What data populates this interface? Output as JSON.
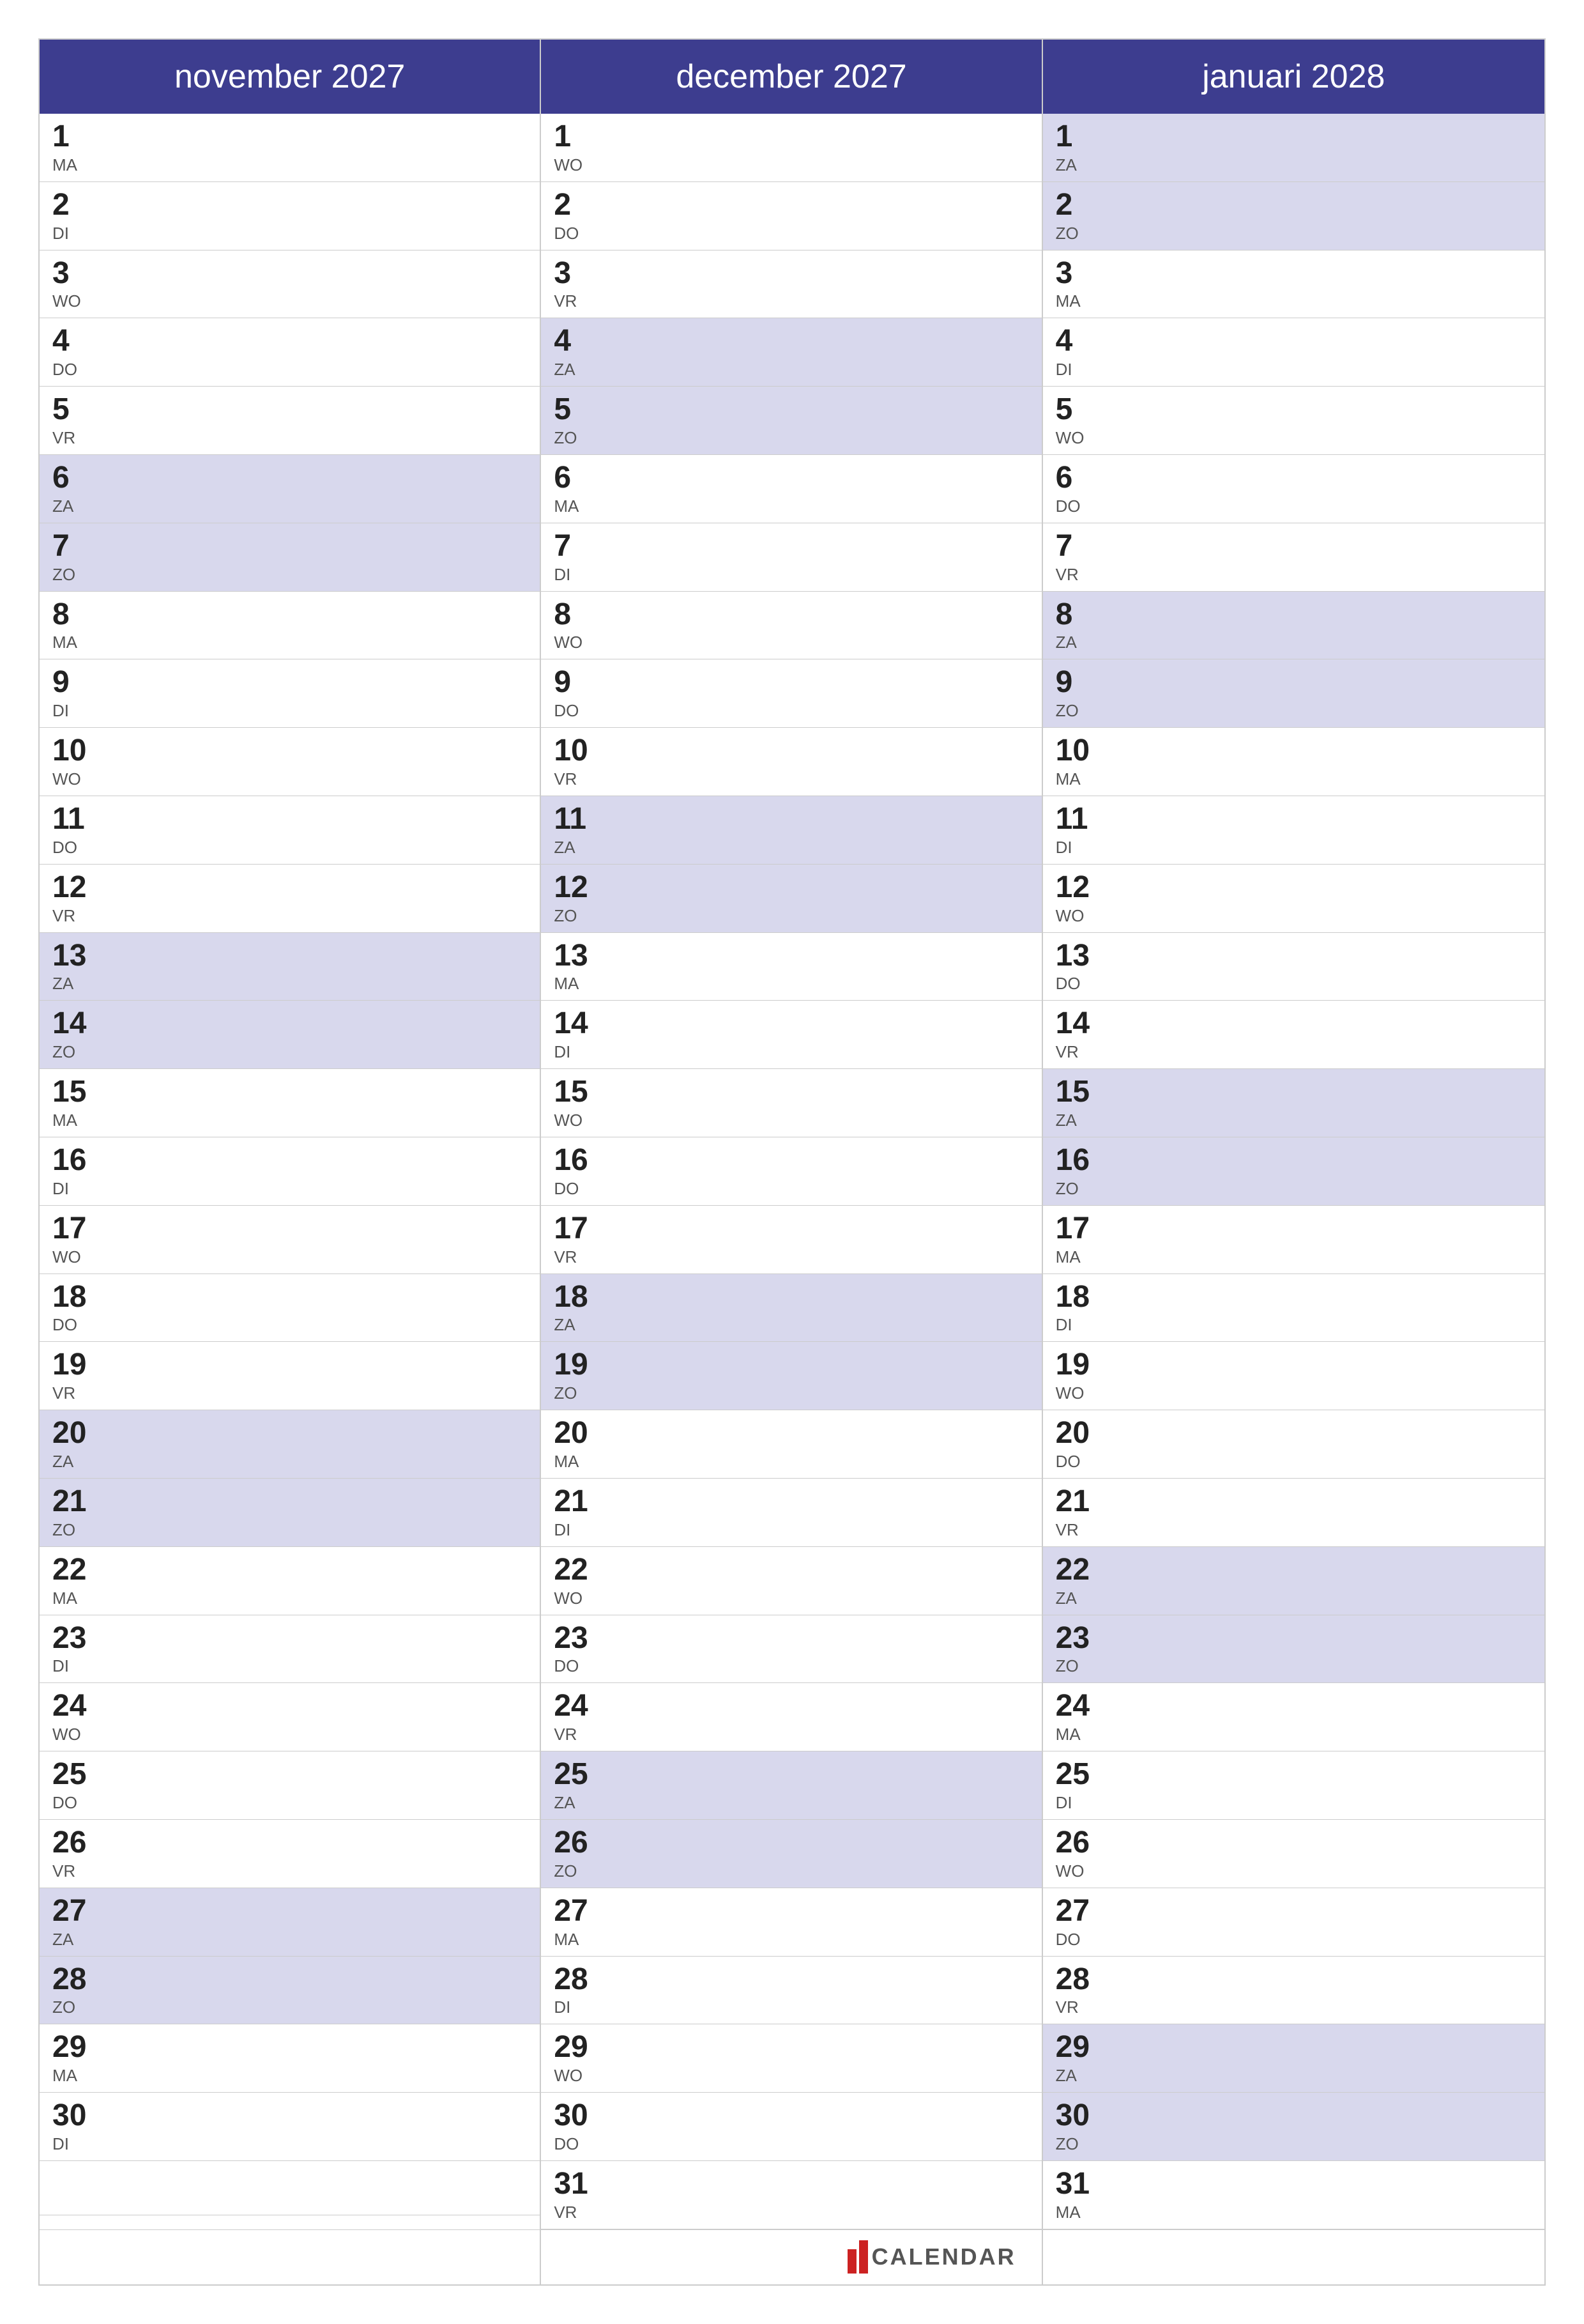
{
  "months": [
    {
      "name": "november 2027",
      "days": [
        {
          "num": "1",
          "abbr": "MA",
          "highlight": false
        },
        {
          "num": "2",
          "abbr": "DI",
          "highlight": false
        },
        {
          "num": "3",
          "abbr": "WO",
          "highlight": false
        },
        {
          "num": "4",
          "abbr": "DO",
          "highlight": false
        },
        {
          "num": "5",
          "abbr": "VR",
          "highlight": false
        },
        {
          "num": "6",
          "abbr": "ZA",
          "highlight": true
        },
        {
          "num": "7",
          "abbr": "ZO",
          "highlight": true
        },
        {
          "num": "8",
          "abbr": "MA",
          "highlight": false
        },
        {
          "num": "9",
          "abbr": "DI",
          "highlight": false
        },
        {
          "num": "10",
          "abbr": "WO",
          "highlight": false
        },
        {
          "num": "11",
          "abbr": "DO",
          "highlight": false
        },
        {
          "num": "12",
          "abbr": "VR",
          "highlight": false
        },
        {
          "num": "13",
          "abbr": "ZA",
          "highlight": true
        },
        {
          "num": "14",
          "abbr": "ZO",
          "highlight": true
        },
        {
          "num": "15",
          "abbr": "MA",
          "highlight": false
        },
        {
          "num": "16",
          "abbr": "DI",
          "highlight": false
        },
        {
          "num": "17",
          "abbr": "WO",
          "highlight": false
        },
        {
          "num": "18",
          "abbr": "DO",
          "highlight": false
        },
        {
          "num": "19",
          "abbr": "VR",
          "highlight": false
        },
        {
          "num": "20",
          "abbr": "ZA",
          "highlight": true
        },
        {
          "num": "21",
          "abbr": "ZO",
          "highlight": true
        },
        {
          "num": "22",
          "abbr": "MA",
          "highlight": false
        },
        {
          "num": "23",
          "abbr": "DI",
          "highlight": false
        },
        {
          "num": "24",
          "abbr": "WO",
          "highlight": false
        },
        {
          "num": "25",
          "abbr": "DO",
          "highlight": false
        },
        {
          "num": "26",
          "abbr": "VR",
          "highlight": false
        },
        {
          "num": "27",
          "abbr": "ZA",
          "highlight": true
        },
        {
          "num": "28",
          "abbr": "ZO",
          "highlight": true
        },
        {
          "num": "29",
          "abbr": "MA",
          "highlight": false
        },
        {
          "num": "30",
          "abbr": "DI",
          "highlight": false
        }
      ],
      "extra": null,
      "footer_type": "empty"
    },
    {
      "name": "december 2027",
      "days": [
        {
          "num": "1",
          "abbr": "WO",
          "highlight": false
        },
        {
          "num": "2",
          "abbr": "DO",
          "highlight": false
        },
        {
          "num": "3",
          "abbr": "VR",
          "highlight": false
        },
        {
          "num": "4",
          "abbr": "ZA",
          "highlight": true
        },
        {
          "num": "5",
          "abbr": "ZO",
          "highlight": true
        },
        {
          "num": "6",
          "abbr": "MA",
          "highlight": false
        },
        {
          "num": "7",
          "abbr": "DI",
          "highlight": false
        },
        {
          "num": "8",
          "abbr": "WO",
          "highlight": false
        },
        {
          "num": "9",
          "abbr": "DO",
          "highlight": false
        },
        {
          "num": "10",
          "abbr": "VR",
          "highlight": false
        },
        {
          "num": "11",
          "abbr": "ZA",
          "highlight": true
        },
        {
          "num": "12",
          "abbr": "ZO",
          "highlight": true
        },
        {
          "num": "13",
          "abbr": "MA",
          "highlight": false
        },
        {
          "num": "14",
          "abbr": "DI",
          "highlight": false
        },
        {
          "num": "15",
          "abbr": "WO",
          "highlight": false
        },
        {
          "num": "16",
          "abbr": "DO",
          "highlight": false
        },
        {
          "num": "17",
          "abbr": "VR",
          "highlight": false
        },
        {
          "num": "18",
          "abbr": "ZA",
          "highlight": true
        },
        {
          "num": "19",
          "abbr": "ZO",
          "highlight": true
        },
        {
          "num": "20",
          "abbr": "MA",
          "highlight": false
        },
        {
          "num": "21",
          "abbr": "DI",
          "highlight": false
        },
        {
          "num": "22",
          "abbr": "WO",
          "highlight": false
        },
        {
          "num": "23",
          "abbr": "DO",
          "highlight": false
        },
        {
          "num": "24",
          "abbr": "VR",
          "highlight": false
        },
        {
          "num": "25",
          "abbr": "ZA",
          "highlight": true
        },
        {
          "num": "26",
          "abbr": "ZO",
          "highlight": true
        },
        {
          "num": "27",
          "abbr": "MA",
          "highlight": false
        },
        {
          "num": "28",
          "abbr": "DI",
          "highlight": false
        },
        {
          "num": "29",
          "abbr": "WO",
          "highlight": false
        },
        {
          "num": "30",
          "abbr": "DO",
          "highlight": false
        },
        {
          "num": "31",
          "abbr": "VR",
          "highlight": false
        }
      ],
      "footer_type": "branding",
      "brand_label": "CALENDAR"
    },
    {
      "name": "januari 2028",
      "days": [
        {
          "num": "1",
          "abbr": "ZA",
          "highlight": true
        },
        {
          "num": "2",
          "abbr": "ZO",
          "highlight": true
        },
        {
          "num": "3",
          "abbr": "MA",
          "highlight": false
        },
        {
          "num": "4",
          "abbr": "DI",
          "highlight": false
        },
        {
          "num": "5",
          "abbr": "WO",
          "highlight": false
        },
        {
          "num": "6",
          "abbr": "DO",
          "highlight": false
        },
        {
          "num": "7",
          "abbr": "VR",
          "highlight": false
        },
        {
          "num": "8",
          "abbr": "ZA",
          "highlight": true
        },
        {
          "num": "9",
          "abbr": "ZO",
          "highlight": true
        },
        {
          "num": "10",
          "abbr": "MA",
          "highlight": false
        },
        {
          "num": "11",
          "abbr": "DI",
          "highlight": false
        },
        {
          "num": "12",
          "abbr": "WO",
          "highlight": false
        },
        {
          "num": "13",
          "abbr": "DO",
          "highlight": false
        },
        {
          "num": "14",
          "abbr": "VR",
          "highlight": false
        },
        {
          "num": "15",
          "abbr": "ZA",
          "highlight": true
        },
        {
          "num": "16",
          "abbr": "ZO",
          "highlight": true
        },
        {
          "num": "17",
          "abbr": "MA",
          "highlight": false
        },
        {
          "num": "18",
          "abbr": "DI",
          "highlight": false
        },
        {
          "num": "19",
          "abbr": "WO",
          "highlight": false
        },
        {
          "num": "20",
          "abbr": "DO",
          "highlight": false
        },
        {
          "num": "21",
          "abbr": "VR",
          "highlight": false
        },
        {
          "num": "22",
          "abbr": "ZA",
          "highlight": true
        },
        {
          "num": "23",
          "abbr": "ZO",
          "highlight": true
        },
        {
          "num": "24",
          "abbr": "MA",
          "highlight": false
        },
        {
          "num": "25",
          "abbr": "DI",
          "highlight": false
        },
        {
          "num": "26",
          "abbr": "WO",
          "highlight": false
        },
        {
          "num": "27",
          "abbr": "DO",
          "highlight": false
        },
        {
          "num": "28",
          "abbr": "VR",
          "highlight": false
        },
        {
          "num": "29",
          "abbr": "ZA",
          "highlight": true
        },
        {
          "num": "30",
          "abbr": "ZO",
          "highlight": true
        },
        {
          "num": "31",
          "abbr": "MA",
          "highlight": false
        }
      ],
      "footer_type": "empty"
    }
  ]
}
